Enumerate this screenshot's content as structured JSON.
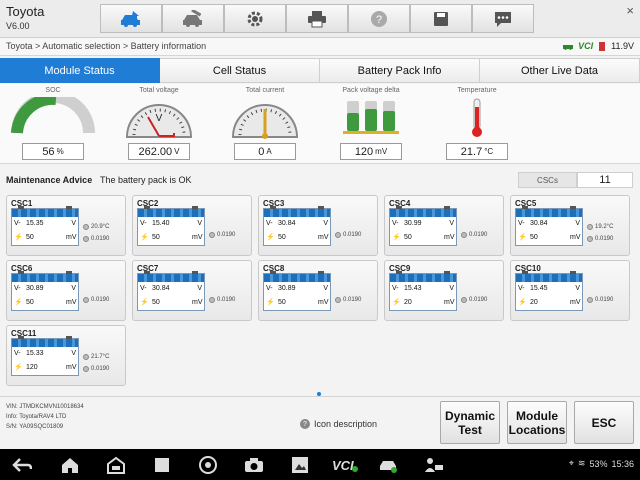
{
  "app": {
    "title": "Toyota",
    "version": "V6.00"
  },
  "toolbar": [
    "home-car-icon",
    "service-car-icon",
    "settings-icon",
    "print-icon",
    "help-icon",
    "save-icon",
    "message-icon"
  ],
  "breadcrumb": "Toyota > Automatic selection > Battery information",
  "status": {
    "vci": "VCI",
    "voltage": "11.9V"
  },
  "tabs": [
    {
      "label": "Module Status",
      "active": true
    },
    {
      "label": "Cell Status",
      "active": false
    },
    {
      "label": "Battery Pack Info",
      "active": false
    },
    {
      "label": "Other Live Data",
      "active": false
    }
  ],
  "gauges": {
    "soc": {
      "title": "SOC",
      "value": "56",
      "unit": "%"
    },
    "voltage": {
      "title": "Total voltage",
      "value": "262.00",
      "unit": "V"
    },
    "current": {
      "title": "Total current",
      "value": "0",
      "unit": "A"
    },
    "delta": {
      "title": "Pack voltage delta",
      "value": "120",
      "unit": "mV"
    },
    "temp": {
      "title": "Temperature",
      "value": "21.7",
      "unit": "°C"
    }
  },
  "maintenance": {
    "label": "Maintenance Advice",
    "text": "The battery pack is OK",
    "csc_label": "CSCs",
    "csc_count": "11"
  },
  "csc": [
    {
      "name": "CSC1",
      "voltage": "15.35",
      "delta": "50",
      "temp": "20.9°C",
      "res": "0.0190"
    },
    {
      "name": "CSC2",
      "voltage": "15.40",
      "delta": "50",
      "temp": "",
      "res": "0.0190"
    },
    {
      "name": "CSC3",
      "voltage": "30.84",
      "delta": "50",
      "temp": "",
      "res": "0.0190"
    },
    {
      "name": "CSC4",
      "voltage": "30.99",
      "delta": "50",
      "temp": "",
      "res": "0.0190"
    },
    {
      "name": "CSC5",
      "voltage": "30.84",
      "delta": "50",
      "temp": "19.2°C",
      "res": "0.0190"
    },
    {
      "name": "CSC6",
      "voltage": "30.89",
      "delta": "50",
      "temp": "",
      "res": "0.0190"
    },
    {
      "name": "CSC7",
      "voltage": "30.84",
      "delta": "50",
      "temp": "",
      "res": "0.0190"
    },
    {
      "name": "CSC8",
      "voltage": "30.89",
      "delta": "50",
      "temp": "",
      "res": "0.0190"
    },
    {
      "name": "CSC9",
      "voltage": "15.43",
      "delta": "20",
      "temp": "",
      "res": "0.0190"
    },
    {
      "name": "CSC10",
      "voltage": "15.45",
      "delta": "20",
      "temp": "",
      "res": "0.0190"
    },
    {
      "name": "CSC11",
      "voltage": "15.33",
      "delta": "120",
      "temp": "21.7°C",
      "res": "0.0190"
    }
  ],
  "cell_labels": {
    "v": "V-",
    "v_unit": "V",
    "mv_unit": "mV"
  },
  "vehicle": {
    "vin": "VIN: JTMDKCMVN10018634",
    "info": "Info: Toyota/RAV4 LTD",
    "sn": "S/N: YA09SQC01809"
  },
  "icon_description": "Icon description",
  "buttons": {
    "dynamic_test": "Dynamic Test",
    "module_locations": "Module Locations",
    "esc": "ESC"
  },
  "system": {
    "battery": "53%",
    "time": "15:36"
  }
}
